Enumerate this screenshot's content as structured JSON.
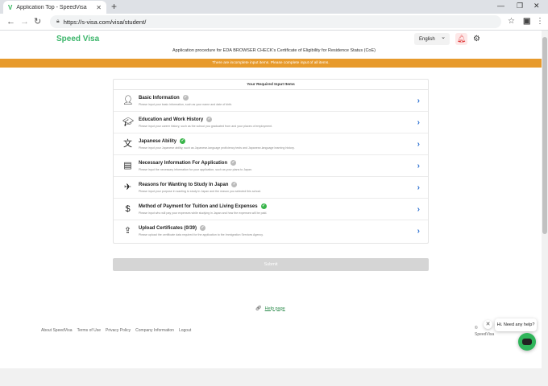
{
  "browser": {
    "tab_title": "Application Top - SpeedVisa",
    "url": "https://s-visa.com/visa/student/"
  },
  "header": {
    "logo": "Speed Visa",
    "language": "English",
    "procedure_title": "Application procedure for EDA BROWSER CHECK's Certificate of Eligibility for Residence Status (CoE)"
  },
  "warning": "There are incomplete input items. Please complete input of all items.",
  "card": {
    "title": "Your Required Input Items",
    "items": [
      {
        "title": "Basic Information",
        "desc": "Please input your basic information, such as your name and date of birth.",
        "status": "pending",
        "icon": "person-icon"
      },
      {
        "title": "Education and Work History",
        "desc": "Please input your career history, such as the school you graduated from and your places of employment.",
        "status": "pending",
        "icon": "graduation-cap-icon"
      },
      {
        "title": "Japanese Ability",
        "desc": "Please input your Japanese ability, such as Japanese-language proficiency tests and Japanese-language learning history.",
        "status": "done",
        "icon": "language-icon"
      },
      {
        "title": "Necessary Information For Application",
        "desc": "Please input the necessary information for your application, such as your plans to Japan.",
        "status": "pending",
        "icon": "document-icon"
      },
      {
        "title": "Reasons for Wanting to Study In Japan",
        "desc": "Please input your purpose in wanting to study in Japan and the reason you selected this school.",
        "status": "pending",
        "icon": "airplane-icon"
      },
      {
        "title": "Method of Payment for Tuition and Living Expenses",
        "desc": "Please input who will pay your expenses while studying in Japan and how the expenses will be paid.",
        "status": "done",
        "icon": "dollar-icon"
      },
      {
        "title": "Upload Certificates (0/39)",
        "desc": "Please upload the certificate data required for the application to the Immigration Services Agency.",
        "status": "pending",
        "icon": "upload-file-icon"
      }
    ]
  },
  "submit_label": "Submit",
  "help_label": "Help page",
  "footer_links": [
    "About SpeedVisa",
    "Terms of Use",
    "Privacy Policy",
    "Company Information",
    "Logout"
  ],
  "copyright": [
    "©",
    "SpeedVisa"
  ],
  "chat": {
    "bubble_text": "Hi. Need any help?"
  },
  "colors": {
    "brand": "#3cb66b",
    "warning": "#e79a2c",
    "arrow": "#2a6fd1",
    "done": "#39b54a",
    "pending": "#bbbbbb"
  }
}
